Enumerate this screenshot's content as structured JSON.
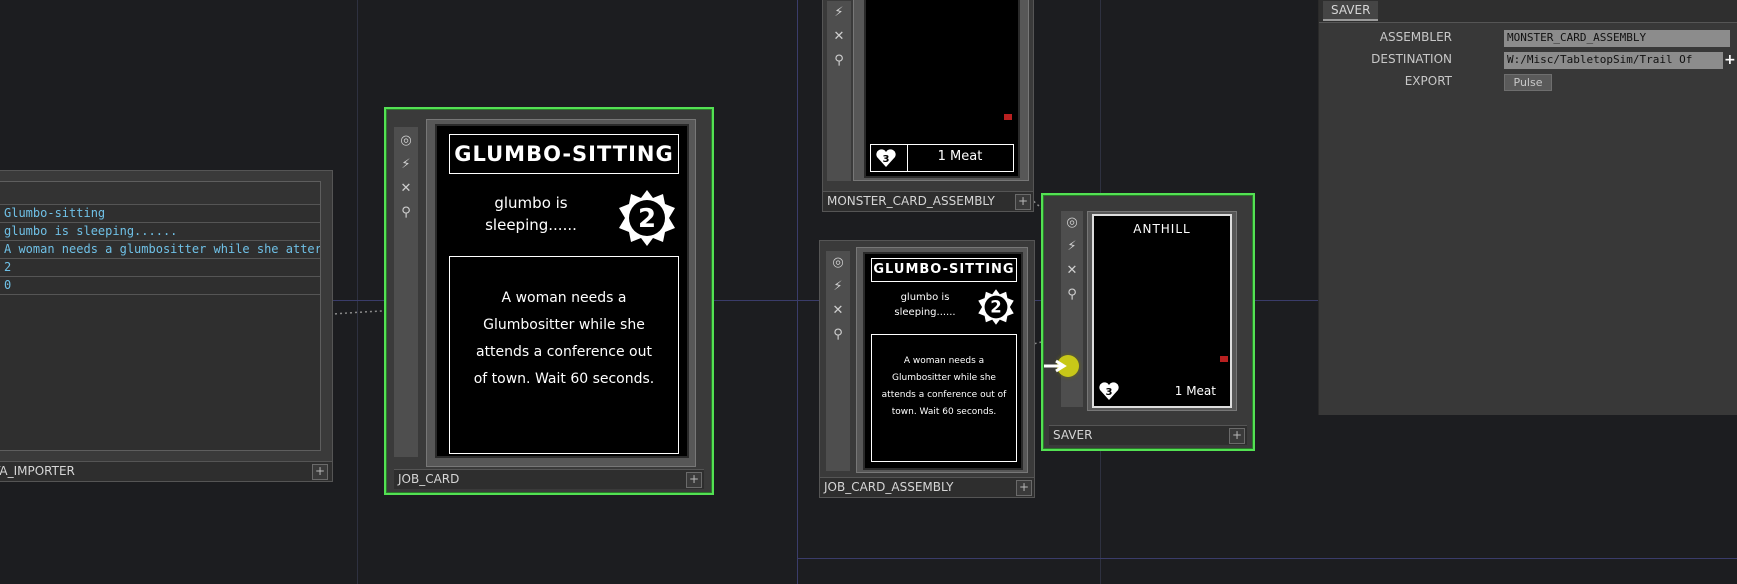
{
  "nodes": {
    "data_importer": {
      "label": "TA_IMPORTER",
      "rows": [
        "Glumbo-sitting",
        "glumbo is sleeping......",
        "A woman needs a glumbositter while she atter",
        "2",
        "0"
      ]
    },
    "job_card": {
      "label": "JOB_CARD",
      "card": {
        "title": "GLUMBO-SITTING",
        "subtitle": "glumbo is sleeping......",
        "badge": "2",
        "body": "A woman needs a Glumbositter while she attends a conference out of town. Wait 60 seconds."
      }
    },
    "monster_card_assembly": {
      "label": "MONSTER_CARD_ASSEMBLY",
      "card": {
        "badge": "3",
        "meat": "1 Meat"
      }
    },
    "job_card_assembly": {
      "label": "JOB_CARD_ASSEMBLY",
      "card": {
        "title": "GLUMBO-SITTING",
        "subtitle": "glumbo is sleeping......",
        "badge": "2",
        "body": "A woman needs a Glumbositter while she attends a conference out of town. Wait 60 seconds."
      }
    },
    "saver": {
      "label": "SAVER",
      "card": {
        "title": "ANTHILL",
        "badge": "3",
        "meat": "1 Meat"
      }
    }
  },
  "params_panel": {
    "tab": "SAVER",
    "assembler_label": "ASSEMBLER",
    "assembler_value": "MONSTER_CARD_ASSEMBLY",
    "destination_label": "DESTINATION",
    "destination_value": "W:/Misc/TabletopSim/Trail Of",
    "export_label": "EXPORT",
    "export_button": "Pulse"
  },
  "colors": {
    "selection": "#53e153",
    "background": "#1c1d20",
    "table_text": "#6fc0e6",
    "pulse_dot": "#c8c818"
  },
  "icons": [
    "viewer-icon",
    "bypass-icon",
    "close-icon",
    "lock-icon",
    "plus-icon",
    "heart-icon",
    "gear-badge-icon",
    "arrow-right-icon"
  ]
}
